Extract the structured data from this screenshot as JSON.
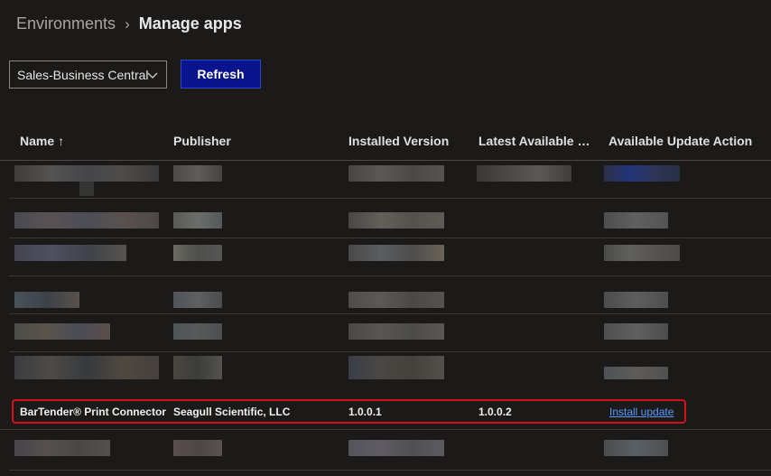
{
  "breadcrumb": {
    "parent": "Environments",
    "separator": "›",
    "current": "Manage apps"
  },
  "toolbar": {
    "environment": "Sales-Business Central",
    "refresh_label": "Refresh"
  },
  "table": {
    "columns": {
      "name": "Name",
      "name_sort": "↑",
      "publisher": "Publisher",
      "installed_version": "Installed Version",
      "latest_version": "Latest Available V...",
      "update_action": "Available Update Action"
    },
    "highlighted_row": {
      "name": "BarTender® Print Connector",
      "publisher": "Seagull Scientific, LLC",
      "installed_version": "1.0.0.1",
      "latest_version": "1.0.0.2",
      "action": "Install update"
    }
  },
  "colors": {
    "background": "#1b1a19",
    "refresh_button": "#0a148c",
    "highlight_border": "#d6101b",
    "link": "#5b9bff"
  }
}
